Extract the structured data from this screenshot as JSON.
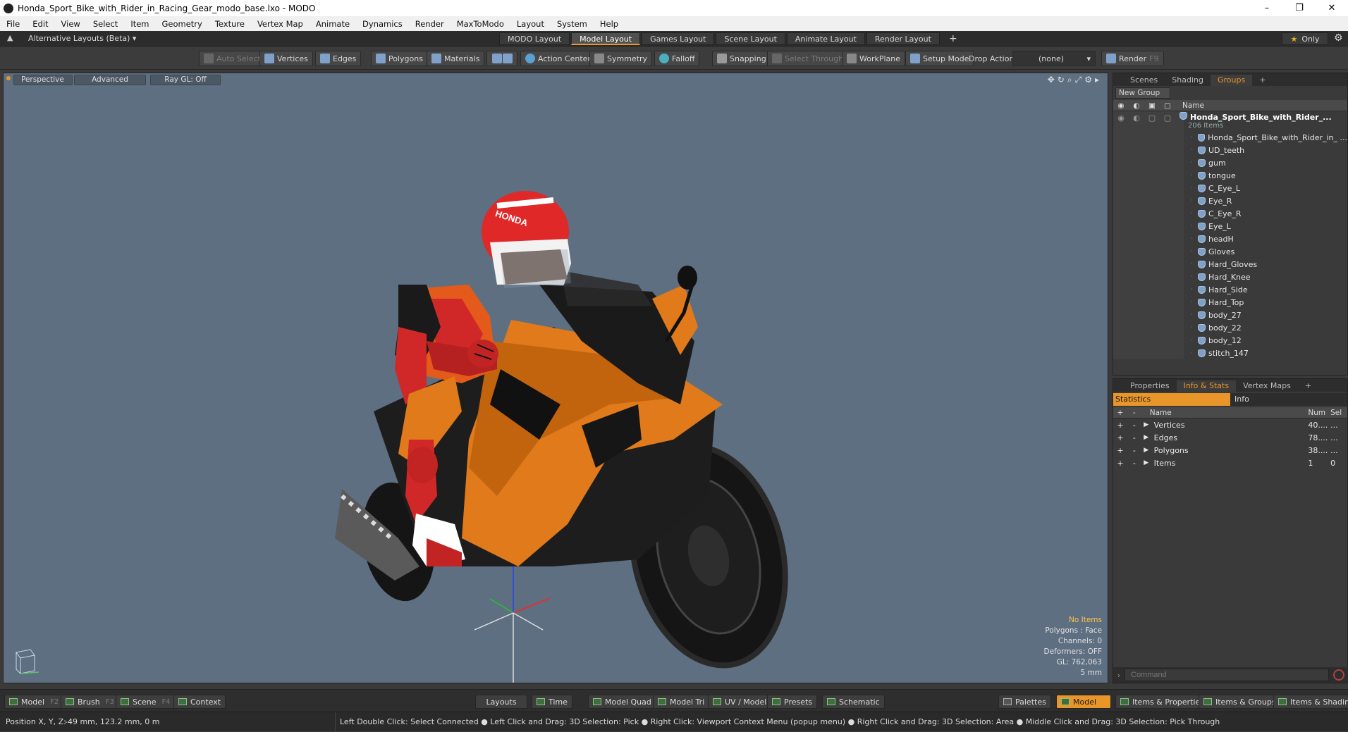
{
  "window": {
    "title": "Honda_Sport_Bike_with_Rider_in_Racing_Gear_modo_base.lxo - MODO",
    "controls": [
      "–",
      "❐",
      "✕"
    ]
  },
  "menubar": [
    "File",
    "Edit",
    "View",
    "Select",
    "Item",
    "Geometry",
    "Texture",
    "Vertex Map",
    "Animate",
    "Dynamics",
    "Render",
    "MaxToModo",
    "Layout",
    "System",
    "Help"
  ],
  "layoutbar": {
    "alt_layouts": "Alternative Layouts (Beta) ▾",
    "tabs": [
      "MODO Layout",
      "Model Layout",
      "Games Layout",
      "Scene Layout",
      "Animate Layout",
      "Render Layout"
    ],
    "active_tab": "Model Layout",
    "add": "+",
    "only_label": "Only",
    "star": "★"
  },
  "toolbar": {
    "auto_select": "Auto Select",
    "vertices": "Vertices",
    "edges": "Edges",
    "polygons": "Polygons",
    "materials": "Materials",
    "action_center": "Action Center",
    "symmetry": "Symmetry",
    "falloff": "Falloff",
    "snapping": "Snapping",
    "select_through": "Select Through",
    "workplane": "WorkPlane",
    "setup_mode": "Setup Mode",
    "drop_action": "Drop Action",
    "drop_value": "(none)",
    "render": "Render",
    "render_key": "F9"
  },
  "viewport": {
    "perspective": "Perspective",
    "advanced": "Advanced",
    "raygl": "Ray GL: Off",
    "hud": {
      "items": "No Items",
      "polygons": "Polygons : Face",
      "channels": "Channels: 0",
      "deformers": "Deformers: OFF",
      "gl": "GL: 762,063",
      "scale": "5 mm"
    }
  },
  "scene_panel": {
    "tabs": [
      "Scenes",
      "Shading",
      "Groups"
    ],
    "active_tab": "Groups",
    "new_group": "New Group",
    "name_header": "Name",
    "root": {
      "name": "Honda_Sport_Bike_with_Rider_...",
      "count": "206 Items"
    },
    "items": [
      "Honda_Sport_Bike_with_Rider_in_ ...",
      "UD_teeth",
      "gum",
      "tongue",
      "C_Eye_L",
      "Eye_R",
      "C_Eye_R",
      "Eye_L",
      "headH",
      "Gloves",
      "Hard_Gloves",
      "Hard_Knee",
      "Hard_Side",
      "Hard_Top",
      "body_27",
      "body_22",
      "body_12",
      "stitch_147"
    ]
  },
  "props_panel": {
    "tabs": [
      "Properties",
      "Info & Stats",
      "Vertex Maps"
    ],
    "active_tab": "Info & Stats",
    "subtabs": [
      "Statistics",
      "Info"
    ],
    "headers": {
      "name": "Name",
      "num": "Num",
      "sel": "Sel"
    },
    "rows": [
      {
        "name": "Vertices",
        "num": "40....",
        "sel": "..."
      },
      {
        "name": "Edges",
        "num": "78....",
        "sel": "..."
      },
      {
        "name": "Polygons",
        "num": "38....",
        "sel": "..."
      },
      {
        "name": "Items",
        "num": "1",
        "sel": "0"
      }
    ],
    "command_placeholder": "Command"
  },
  "bottombar": {
    "model": "Model",
    "model_key": "F2",
    "brush": "Brush",
    "brush_key": "F3",
    "scene": "Scene",
    "scene_key": "F4",
    "context": "Context",
    "layouts": "Layouts",
    "time": "Time",
    "model_quad": "Model Quad",
    "model_tri": "Model Tri",
    "uv_model": "UV / Model",
    "presets": "Presets",
    "schematic": "Schematic",
    "palettes": "Palettes",
    "model_right": "Model",
    "items_props": "Items & Properties",
    "items_groups": "Items & Groups",
    "items_shading": "Items & Shading"
  },
  "statusbar": {
    "position_label": "Position X, Y, Z:",
    "position": "-49 mm, 123.2 mm, 0 m",
    "hint": "Left Double Click: Select Connected ● Left Click and Drag: 3D Selection: Pick ● Right Click: Viewport Context Menu (popup menu) ● Right Click and Drag: 3D Selection: Area ● Middle Click and Drag: 3D Selection: Pick Through"
  },
  "colors": {
    "accent": "#e8952a",
    "viewport_bg": "#5e6f82",
    "bike_orange": "#e07a1a",
    "rider_red": "#d02828"
  }
}
